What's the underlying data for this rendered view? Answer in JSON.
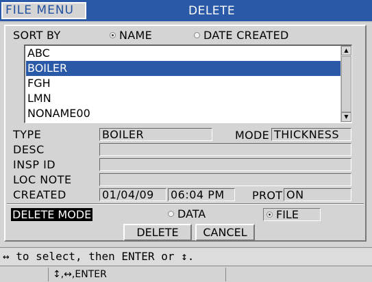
{
  "header": {
    "menu_label": "FILE MENU",
    "title": "DELETE"
  },
  "sort": {
    "label": "SORT BY",
    "options": [
      "NAME",
      "DATE CREATED"
    ],
    "selected": "NAME"
  },
  "files": [
    "ABC",
    "BOILER",
    "FGH",
    "LMN",
    "NONAME00"
  ],
  "selected_file": "BOILER",
  "info": {
    "type_label": "TYPE",
    "type_value": "BOILER",
    "mode_label": "MODE",
    "mode_value": "THICKNESS",
    "desc_label": "DESC",
    "desc_value": "",
    "insp_id_label": "INSP ID",
    "insp_id_value": "",
    "loc_note_label": "LOC NOTE",
    "loc_note_value": "",
    "created_label": "CREATED",
    "created_date": "01/04/09",
    "created_time": "06:04 PM",
    "prot_label": "PROT",
    "prot_value": "ON"
  },
  "delete_mode": {
    "label": "DELETE MODE",
    "options": [
      "DATA",
      "FILE"
    ],
    "selected": "FILE"
  },
  "buttons": {
    "delete": "DELETE",
    "cancel": "CANCEL"
  },
  "help_text": "↔ to select, then ENTER or ↕.",
  "status_text": "↕,↔,ENTER"
}
